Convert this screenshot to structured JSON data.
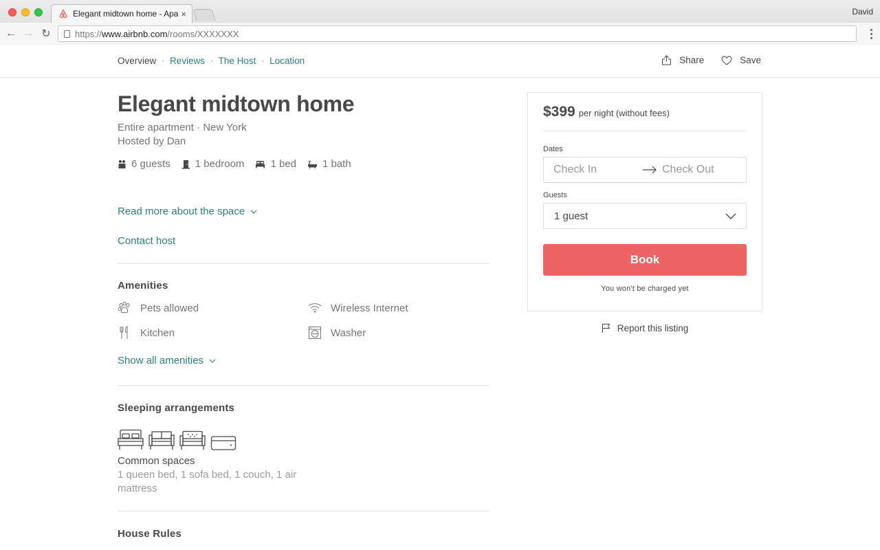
{
  "browser": {
    "tab_title": "Elegant midtown home - Apart",
    "tab_close": "×",
    "user": "David",
    "url_protocol": "https://",
    "url_host": "www.airbnb.com",
    "url_path": "/rooms/XXXXXXX",
    "back_glyph": "←",
    "forward_glyph": "→",
    "reload_glyph": "↻"
  },
  "subnav": {
    "links": [
      "Overview",
      "Reviews",
      "The Host",
      "Location"
    ],
    "separator": "·",
    "share": "Share",
    "save": "Save"
  },
  "listing": {
    "title": "Elegant midtown home",
    "type_location": "Entire apartment · New York",
    "host": "Hosted by Dan",
    "stats": {
      "guests": "6 guests",
      "bedrooms": "1 bedroom",
      "beds": "1 bed",
      "baths": "1 bath"
    },
    "read_more": "Read more about the space",
    "contact_host": "Contact host"
  },
  "amenities": {
    "title": "Amenities",
    "items": [
      {
        "label": "Pets allowed",
        "icon": "paw-icon"
      },
      {
        "label": "Wireless Internet",
        "icon": "wifi-icon"
      },
      {
        "label": "Kitchen",
        "icon": "utensils-icon"
      },
      {
        "label": "Washer",
        "icon": "washer-icon"
      }
    ],
    "show_all": "Show all amenities"
  },
  "sleeping": {
    "title": "Sleeping arrangements",
    "room_name": "Common spaces",
    "room_beds": "1 queen bed, 1 sofa bed, 1 couch, 1 air mattress"
  },
  "house_rules": {
    "title": "House Rules"
  },
  "booking": {
    "price": "$399",
    "price_note": "per night (without fees)",
    "dates_label": "Dates",
    "check_in": "Check In",
    "check_out": "Check Out",
    "guests_label": "Guests",
    "guests_value": "1 guest",
    "book": "Book",
    "disclaimer": "You won't be charged yet"
  },
  "report": "Report this listing",
  "colors": {
    "accent_teal": "#2d7f7f",
    "book_button": "#ee6464",
    "text": "#484848",
    "muted": "#757575"
  }
}
